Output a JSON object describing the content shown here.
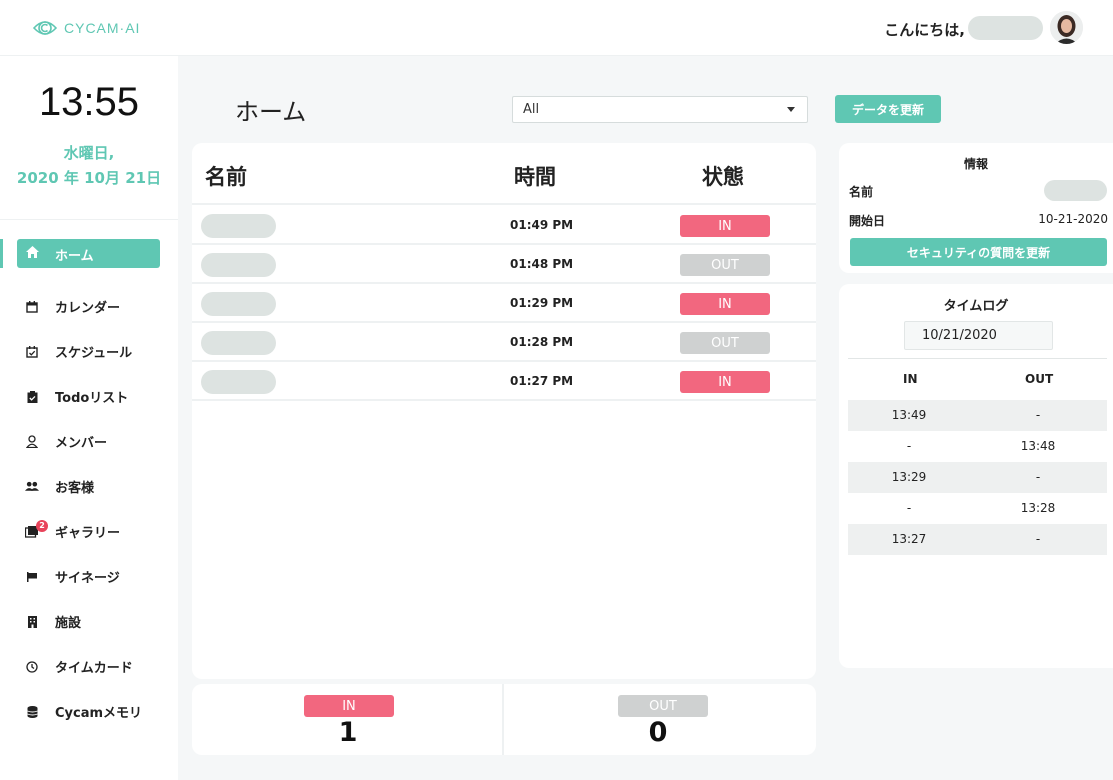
{
  "app": {
    "logo_text": "CYCAM·AI",
    "greeting": "こんにちは,",
    "accent_color": "#5fc7b3"
  },
  "sidebar": {
    "time": "13:55",
    "weekday": "水曜日,",
    "date": "2020 年 10月 21日",
    "items": [
      {
        "label": "ホーム",
        "icon": "home-icon",
        "active": true
      },
      {
        "label": "カレンダー",
        "icon": "calendar-icon"
      },
      {
        "label": "スケジュール",
        "icon": "calendar-check-icon"
      },
      {
        "label": "Todoリスト",
        "icon": "clipboard-icon"
      },
      {
        "label": "メンバー",
        "icon": "user-icon"
      },
      {
        "label": "お客様",
        "icon": "users-icon"
      },
      {
        "label": "ギャラリー",
        "icon": "gallery-icon",
        "badge": "2"
      },
      {
        "label": "サイネージ",
        "icon": "flag-icon"
      },
      {
        "label": "施設",
        "icon": "building-icon"
      },
      {
        "label": "タイムカード",
        "icon": "clock-icon"
      },
      {
        "label": "Cycamメモリ",
        "icon": "database-icon"
      }
    ]
  },
  "main": {
    "title": "ホーム",
    "filter": {
      "selected": "All"
    },
    "refresh_label": "データを更新",
    "table": {
      "headers": {
        "name": "名前",
        "time": "時間",
        "status": "状態"
      },
      "rows": [
        {
          "time": "01:49 PM",
          "status": "IN"
        },
        {
          "time": "01:48 PM",
          "status": "OUT"
        },
        {
          "time": "01:29 PM",
          "status": "IN"
        },
        {
          "time": "01:28 PM",
          "status": "OUT"
        },
        {
          "time": "01:27 PM",
          "status": "IN"
        }
      ]
    },
    "summary": {
      "in_label": "IN",
      "in_count": "1",
      "out_label": "OUT",
      "out_count": "0"
    }
  },
  "info": {
    "title": "情報",
    "name_label": "名前",
    "start_label": "開始日",
    "start_value": "10-21-2020",
    "security_button": "セキュリティの質問を更新"
  },
  "timelog": {
    "title": "タイムログ",
    "date": "10/21/2020",
    "in_header": "IN",
    "out_header": "OUT",
    "rows": [
      {
        "in": "13:49",
        "out": "-"
      },
      {
        "in": "-",
        "out": "13:48"
      },
      {
        "in": "13:29",
        "out": "-"
      },
      {
        "in": "-",
        "out": "13:28"
      },
      {
        "in": "13:27",
        "out": "-"
      }
    ]
  },
  "colors": {
    "in": "#f2677f",
    "out": "#cfd1d1"
  }
}
